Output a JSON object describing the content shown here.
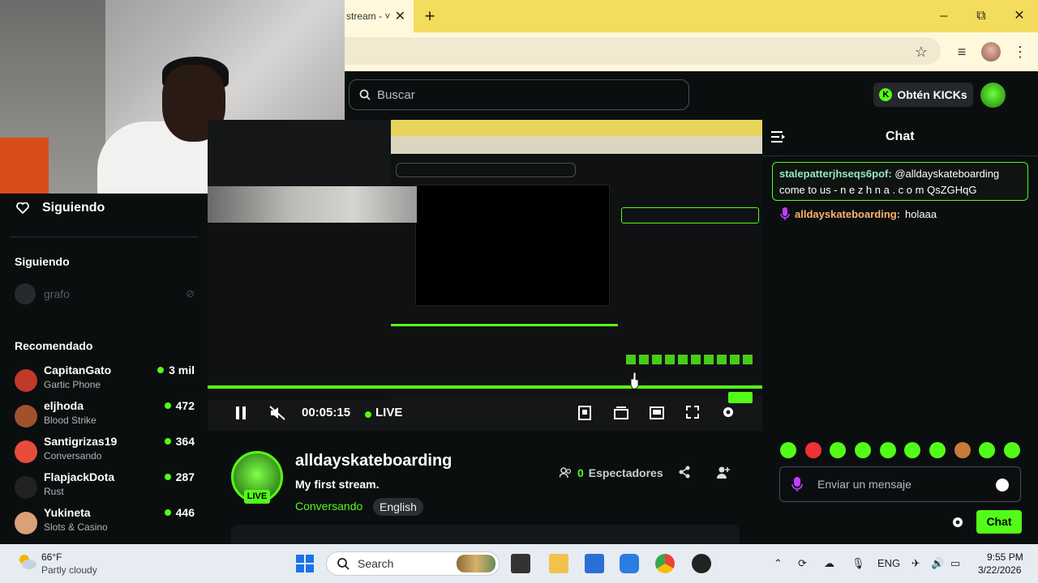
{
  "browser": {
    "tab_title": "stream - ˅",
    "new_tab": "+",
    "window": {
      "minimize": "–",
      "maximize": "⧉",
      "close": "✕"
    }
  },
  "header": {
    "search_placeholder": "Buscar",
    "get_kicks": "Obtén KICKs",
    "get_kicks_icon": "K"
  },
  "sidebar": {
    "following_label": "Siguiendo",
    "following_section": "Siguiendo",
    "followed": [
      {
        "name": "grafo",
        "status_icon": "offline-icon"
      }
    ],
    "recommended_section": "Recomendado",
    "recommended": [
      {
        "name": "CapitanGato",
        "category": "Gartic Phone",
        "viewers": "3 mil",
        "color": "#c0392b"
      },
      {
        "name": "eljhoda",
        "category": "Blood Strike",
        "viewers": "472",
        "color": "#a0522d"
      },
      {
        "name": "Santigrizas19",
        "category": "Conversando",
        "viewers": "364",
        "color": "#e74c3c"
      },
      {
        "name": "FlapjackDota",
        "category": "Rust",
        "viewers": "287",
        "color": "#222222"
      },
      {
        "name": "Yukineta",
        "category": "Slots & Casino",
        "viewers": "446",
        "color": "#d9a07a"
      }
    ]
  },
  "player": {
    "time": "00:05:15",
    "live": "LIVE",
    "progress": 1.0
  },
  "stream": {
    "channel": "alldayskateboarding",
    "title": "My first stream.",
    "category": "Conversando",
    "language": "English",
    "live_badge": "LIVE",
    "viewers_count": "0",
    "viewers_label": "Espectadores"
  },
  "chat": {
    "title": "Chat",
    "pinned_user": "stalepatterjhseqs6pof:",
    "pinned_text": "@alldayskateboarding come to us - n e z h n a . c o m QsZGHqG",
    "msg_user": "alldayskateboarding:",
    "msg_text": "holaaa",
    "input_placeholder": "Enviar un mensaje",
    "send_label": "Chat"
  },
  "taskbar": {
    "temp": "66°F",
    "weather": "Partly cloudy",
    "search": "Search",
    "lang": "ENG",
    "time": "9:55 PM",
    "date": "3/22/2026"
  },
  "colors": {
    "accent": "#53fc18",
    "chrome_tab": "#f4dc5c"
  }
}
